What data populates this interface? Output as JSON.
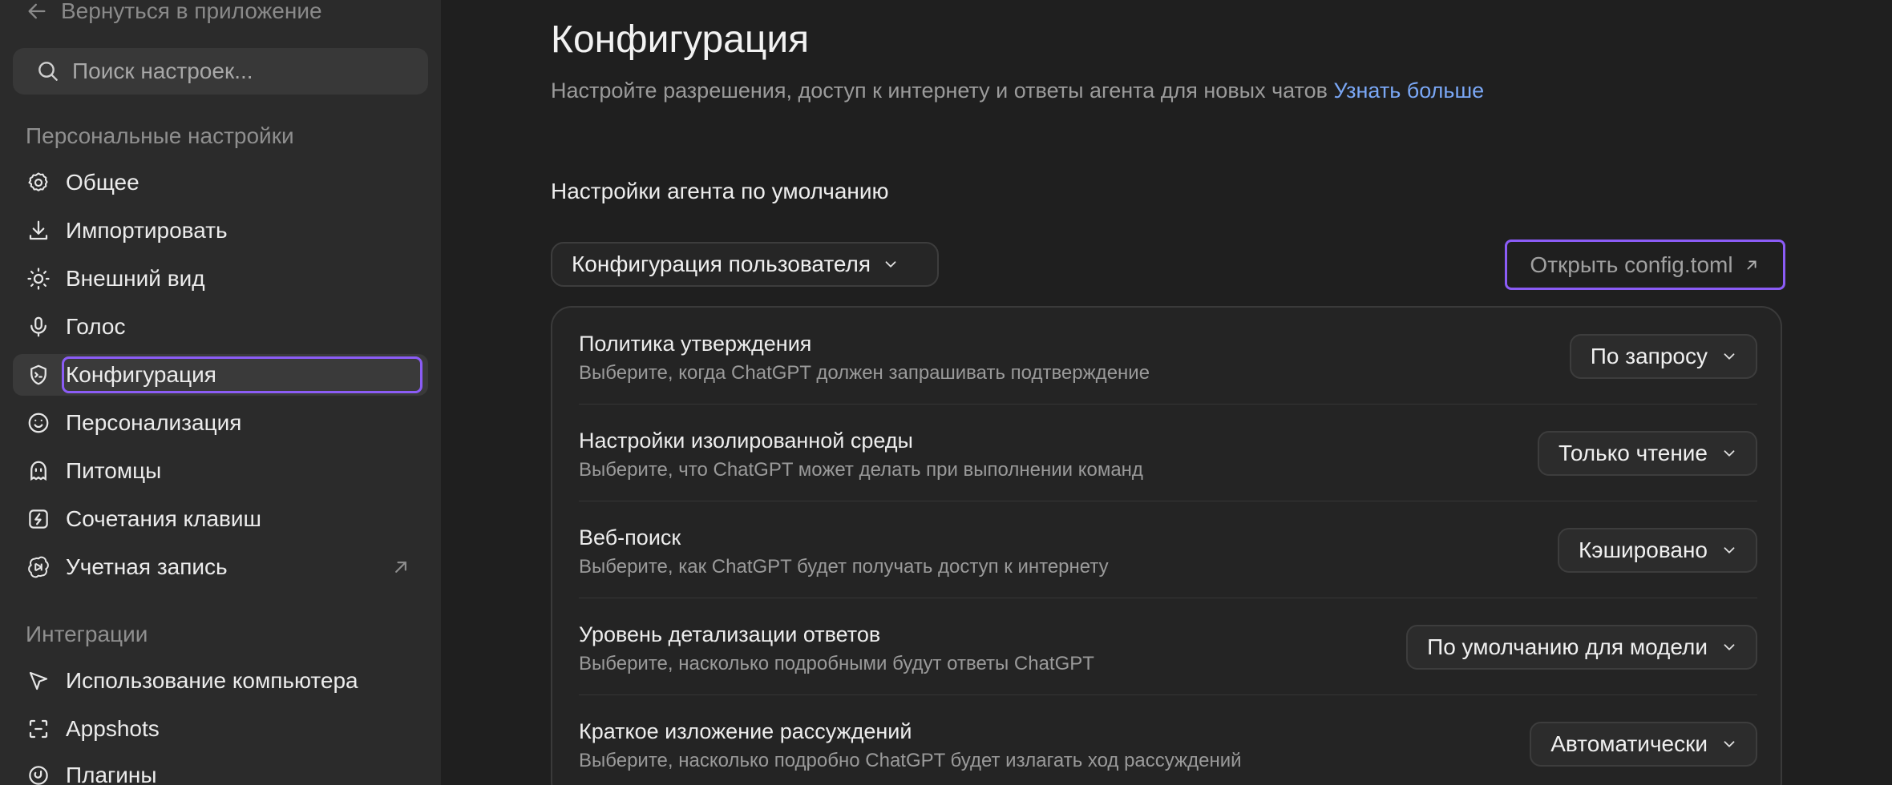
{
  "sidebar": {
    "back_label": "Вернуться в приложение",
    "search_placeholder": "Поиск настроек...",
    "personal_section": "Персональные настройки",
    "items": [
      {
        "label": "Общее",
        "icon": "gear-icon"
      },
      {
        "label": "Импортировать",
        "icon": "download-icon"
      },
      {
        "label": "Внешний вид",
        "icon": "sun-icon"
      },
      {
        "label": "Голос",
        "icon": "microphone-icon"
      },
      {
        "label": "Конфигурация",
        "icon": "shield-icon",
        "active": true
      },
      {
        "label": "Персонализация",
        "icon": "smile-icon"
      },
      {
        "label": "Питомцы",
        "icon": "pet-icon"
      },
      {
        "label": "Сочетания клавиш",
        "icon": "keyboard-shortcut-icon"
      },
      {
        "label": "Учетная запись",
        "icon": "openai-logo-icon",
        "external": true
      }
    ],
    "integrations_section": "Интеграции",
    "integrations": [
      {
        "label": "Использование компьютера",
        "icon": "cursor-icon"
      },
      {
        "label": "Appshots",
        "icon": "screenshot-icon"
      },
      {
        "label": "Плагины",
        "icon": "plugin-icon"
      }
    ]
  },
  "main": {
    "title": "Конфигурация",
    "subtitle": "Настройте разрешения, доступ к интернету и ответы агента для новых чатов",
    "learn_more": "Узнать больше",
    "section_heading": "Настройки агента по умолчанию",
    "profile_dropdown": "Конфигурация пользователя",
    "open_config": "Открыть config.toml",
    "settings": [
      {
        "title": "Политика утверждения",
        "desc": "Выберите, когда ChatGPT должен запрашивать подтверждение",
        "value": "По запросу"
      },
      {
        "title": "Настройки изолированной среды",
        "desc": "Выберите, что ChatGPT может делать при выполнении команд",
        "value": "Только чтение"
      },
      {
        "title": "Веб-поиск",
        "desc": "Выберите, как ChatGPT будет получать доступ к интернету",
        "value": "Кэшировано"
      },
      {
        "title": "Уровень детализации ответов",
        "desc": "Выберите, насколько подробными будут ответы ChatGPT",
        "value": "По умолчанию для модели"
      },
      {
        "title": "Краткое изложение рассуждений",
        "desc": "Выберите, насколько подробно ChatGPT будет излагать ход рассуждений",
        "value": "Автоматически"
      }
    ]
  },
  "colors": {
    "background": "#1f1f1f",
    "sidebar": "#2b2b2b",
    "accent_focus": "#8b5cf6",
    "link": "#7aa7f5"
  }
}
